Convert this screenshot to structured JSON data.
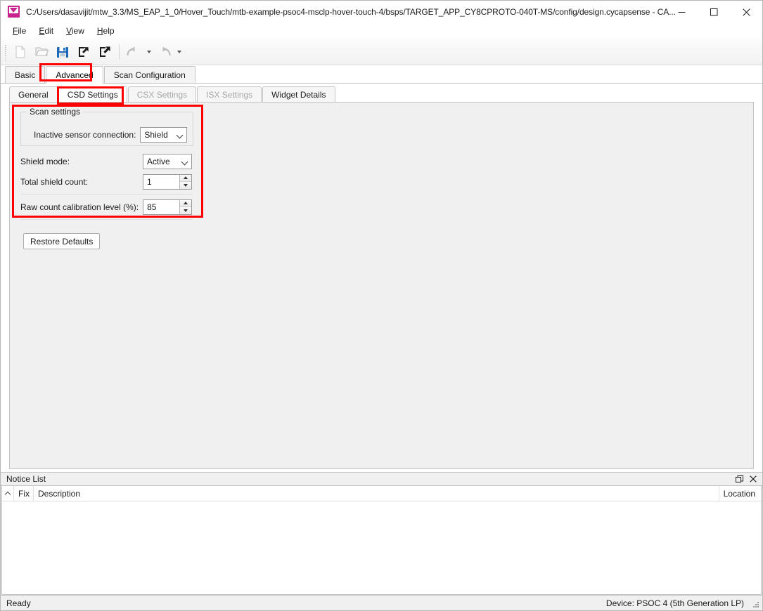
{
  "window": {
    "title": "C:/Users/dasavijit/mtw_3.3/MS_EAP_1_0/Hover_Touch/mtb-example-psoc4-msclp-hover-touch-4/bsps/TARGET_APP_CY8CPROTO-040T-MS/config/design.cycapsense - CA...",
    "icon": "capsense-configurator-icon",
    "controls": {
      "minimize": "minimize-icon",
      "maximize": "maximize-icon",
      "close": "close-icon"
    }
  },
  "menubar": {
    "items": [
      {
        "label": "File",
        "mnemonic": "F"
      },
      {
        "label": "Edit",
        "mnemonic": "E"
      },
      {
        "label": "View",
        "mnemonic": "V"
      },
      {
        "label": "Help",
        "mnemonic": "H"
      }
    ]
  },
  "toolbar": {
    "buttons": [
      {
        "name": "new-file-icon",
        "label": "New",
        "enabled": false
      },
      {
        "name": "open-folder-icon",
        "label": "Open",
        "enabled": false
      },
      {
        "name": "save-icon",
        "label": "Save",
        "enabled": true
      },
      {
        "name": "import-icon",
        "label": "Import",
        "enabled": true
      },
      {
        "name": "export-icon",
        "label": "Export",
        "enabled": true
      },
      {
        "name": "undo-icon",
        "label": "Undo",
        "enabled": false
      },
      {
        "name": "redo-icon",
        "label": "Redo",
        "enabled": false
      }
    ]
  },
  "outer_tabs": {
    "items": [
      {
        "label": "Basic",
        "active": false,
        "highlighted": false
      },
      {
        "label": "Advanced",
        "active": true,
        "highlighted": true
      },
      {
        "label": "Scan Configuration",
        "active": false,
        "highlighted": false
      }
    ]
  },
  "inner_tabs": {
    "items": [
      {
        "label": "General",
        "active": false,
        "enabled": true,
        "highlighted": false
      },
      {
        "label": "CSD Settings",
        "active": true,
        "enabled": true,
        "highlighted": true
      },
      {
        "label": "CSX Settings",
        "active": false,
        "enabled": false,
        "highlighted": false
      },
      {
        "label": "ISX Settings",
        "active": false,
        "enabled": false,
        "highlighted": false
      },
      {
        "label": "Widget Details",
        "active": false,
        "enabled": true,
        "highlighted": false
      }
    ]
  },
  "settings": {
    "group_title": "Scan settings",
    "inactive_sensor_connection": {
      "label": "Inactive sensor connection:",
      "value": "Shield",
      "control": "combobox"
    },
    "shield_mode": {
      "label": "Shield mode:",
      "value": "Active",
      "control": "combobox"
    },
    "total_shield_count": {
      "label": "Total shield count:",
      "value": "1",
      "control": "spinbox"
    },
    "raw_count_calibration_level": {
      "label": "Raw count calibration level (%):",
      "value": "85",
      "control": "spinbox"
    },
    "restore_defaults_label": "Restore Defaults"
  },
  "notice_list": {
    "title": "Notice List",
    "float_icon": "float-window-icon",
    "close_icon": "close-icon",
    "columns": [
      {
        "key": "caret",
        "label": ""
      },
      {
        "key": "fix",
        "label": "Fix"
      },
      {
        "key": "description",
        "label": "Description"
      },
      {
        "key": "location",
        "label": "Location"
      }
    ],
    "rows": []
  },
  "statusbar": {
    "status": "Ready",
    "device": "Device: PSOC 4 (5th Generation LP)"
  },
  "annotations": {
    "highlight_color": "#ff0000",
    "boxes": [
      {
        "name": "advanced-tab-highlight"
      },
      {
        "name": "csd-settings-tab-highlight"
      },
      {
        "name": "scan-settings-panel-highlight"
      }
    ]
  }
}
